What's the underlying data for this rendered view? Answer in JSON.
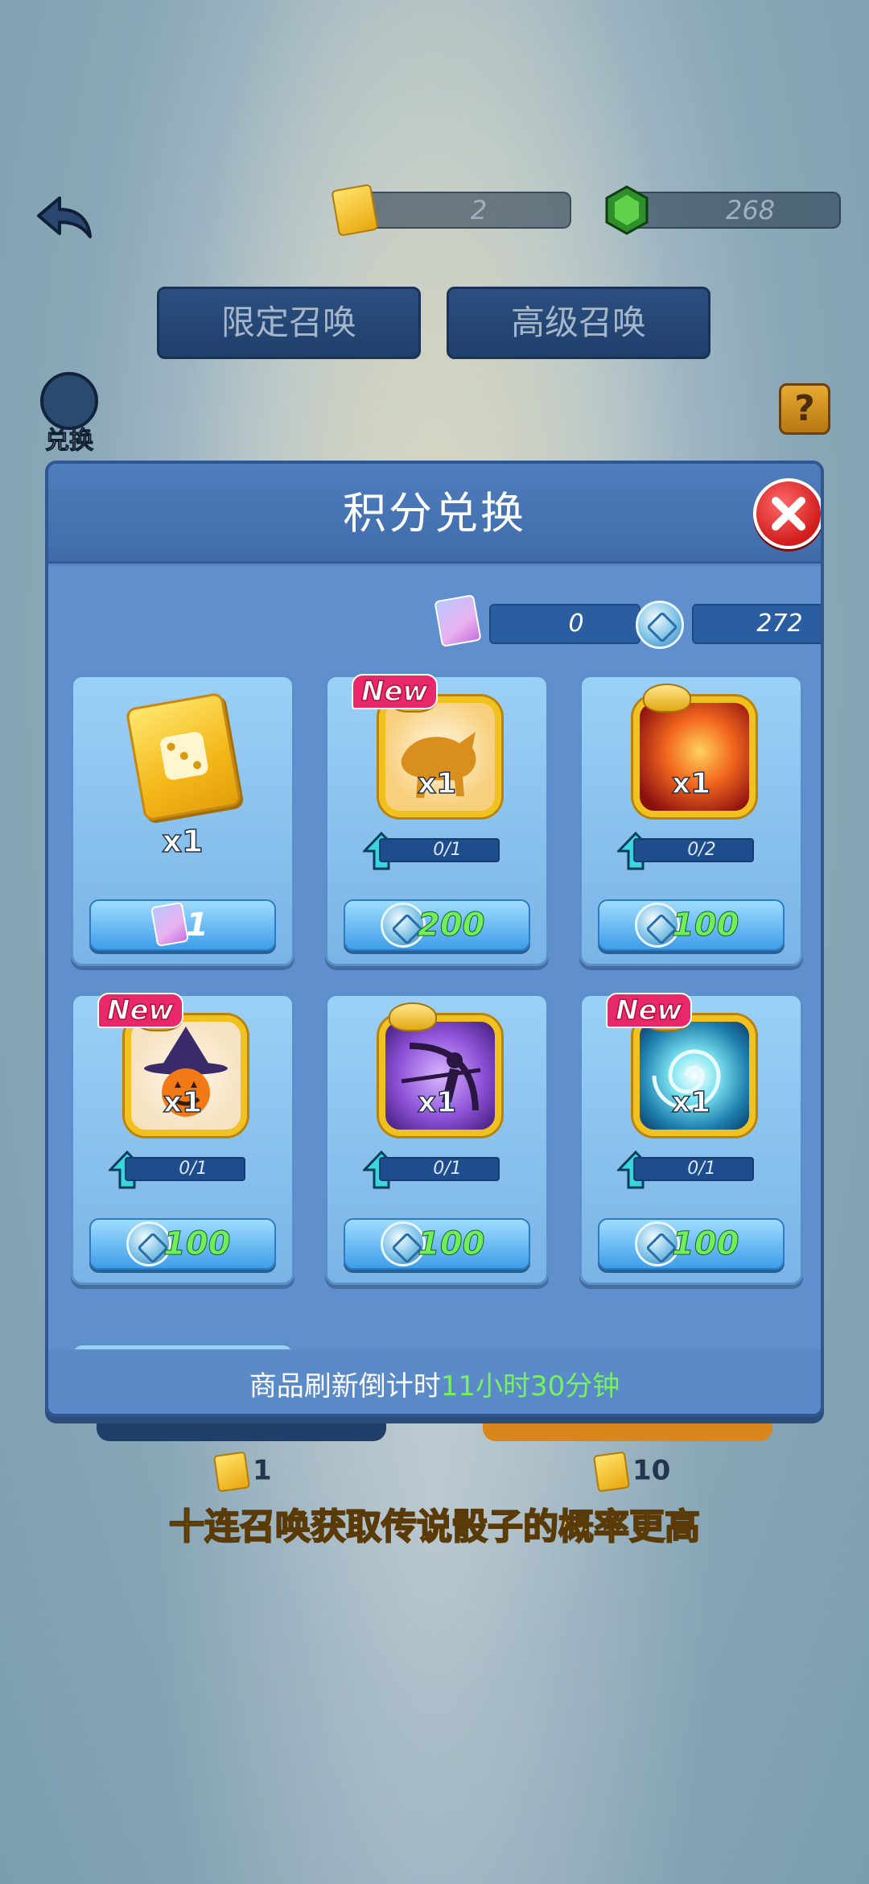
{
  "topbar": {
    "ticket_count": "2",
    "gem_count": "268",
    "tabs": [
      "限定召唤",
      "高级召唤"
    ],
    "redeem_label": "兑换",
    "help_label": "?"
  },
  "background": {
    "single_cost": "1",
    "ten_cost": "10",
    "ten_pull_hint": "十连召唤获取传说骰子的概率更高"
  },
  "modal": {
    "title": "积分兑换",
    "balances": {
      "card_points": "0",
      "coin_points": "272"
    },
    "items": [
      {
        "qty": "x1",
        "price": "1",
        "currency": "card",
        "level": null,
        "is_new": false
      },
      {
        "qty": "x1",
        "price": "200",
        "currency": "coin",
        "level": "0/1",
        "is_new": true
      },
      {
        "qty": "x1",
        "price": "100",
        "currency": "coin",
        "level": "0/2",
        "is_new": false
      },
      {
        "qty": "x1",
        "price": "100",
        "currency": "coin",
        "level": "0/1",
        "is_new": true
      },
      {
        "qty": "x1",
        "price": "100",
        "currency": "coin",
        "level": "0/1",
        "is_new": false
      },
      {
        "qty": "x1",
        "price": "100",
        "currency": "coin",
        "level": "0/1",
        "is_new": true
      }
    ],
    "new_badge": "New",
    "refresh_prefix": "商品刷新倒计时",
    "refresh_time": "11小时30分钟"
  },
  "colors": {
    "modal_bg": "#5f8fcc",
    "price_green": "#6ff05a",
    "new_badge": "#e8286a",
    "close_red": "#d11c1c"
  },
  "icons": [
    "back-arrow-icon",
    "ticket-icon",
    "gem-icon",
    "redeem-icon",
    "help-icon",
    "close-icon",
    "card-point-icon",
    "coin-point-icon",
    "upgrade-arrow-icon"
  ]
}
